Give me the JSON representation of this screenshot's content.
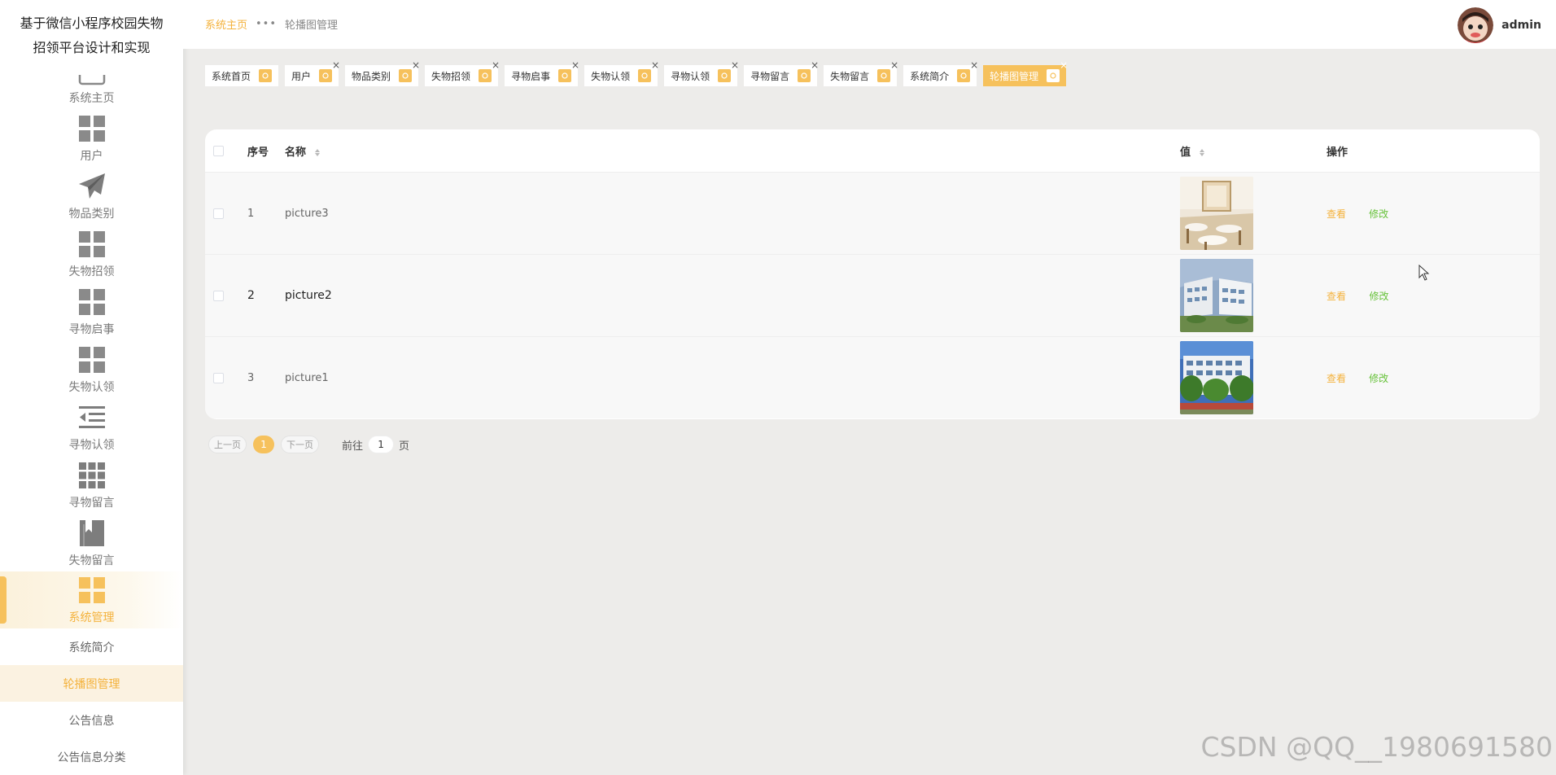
{
  "app": {
    "title_line1": "基于微信小程序校园失物",
    "title_line2": "招领平台设计和实现"
  },
  "sidebar": {
    "items": [
      {
        "label": "系统主页",
        "icon": "home-icon"
      },
      {
        "label": "用户",
        "icon": "grid-icon"
      },
      {
        "label": "物品类别",
        "icon": "paper-plane-icon"
      },
      {
        "label": "失物招领",
        "icon": "grid-icon"
      },
      {
        "label": "寻物启事",
        "icon": "grid-icon"
      },
      {
        "label": "失物认领",
        "icon": "grid-icon"
      },
      {
        "label": "寻物认领",
        "icon": "indent-icon"
      },
      {
        "label": "寻物留言",
        "icon": "apps-icon"
      },
      {
        "label": "失物留言",
        "icon": "book-icon"
      },
      {
        "label": "系统管理",
        "icon": "grid-icon"
      }
    ],
    "submenu": [
      {
        "label": "系统简介"
      },
      {
        "label": "轮播图管理"
      },
      {
        "label": "公告信息"
      },
      {
        "label": "公告信息分类"
      }
    ],
    "accent_color": "#f4b23c"
  },
  "header": {
    "breadcrumb_home": "系统主页",
    "breadcrumb_sep": "•••",
    "breadcrumb_current": "轮播图管理",
    "username": "admin"
  },
  "tags": [
    {
      "label": "系统首页"
    },
    {
      "label": "用户"
    },
    {
      "label": "物品类别"
    },
    {
      "label": "失物招领"
    },
    {
      "label": "寻物启事"
    },
    {
      "label": "失物认领"
    },
    {
      "label": "寻物认领"
    },
    {
      "label": "寻物留言"
    },
    {
      "label": "失物留言"
    },
    {
      "label": "系统简介"
    },
    {
      "label": "轮播图管理"
    }
  ],
  "tag_close": "×",
  "table": {
    "columns": {
      "index": "序号",
      "name": "名称",
      "value": "值",
      "operation": "操作"
    },
    "rows": [
      {
        "index": "1",
        "name": "picture3",
        "view": "查看",
        "edit": "修改"
      },
      {
        "index": "2",
        "name": "picture2",
        "view": "查看",
        "edit": "修改"
      },
      {
        "index": "3",
        "name": "picture1",
        "view": "查看",
        "edit": "修改"
      }
    ]
  },
  "pagination": {
    "prev": "上一页",
    "current": "1",
    "next": "下一页",
    "goto_label": "前往",
    "goto_value": "1",
    "unit": "页"
  },
  "watermark": "CSDN @QQ__1980691580"
}
